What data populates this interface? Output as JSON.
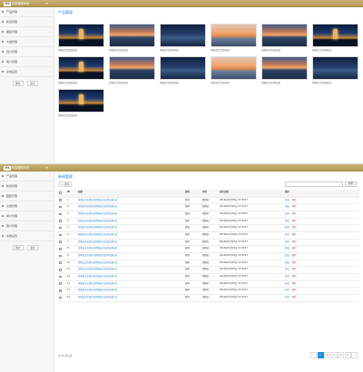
{
  "app": {
    "logo": "MK",
    "title": "内容管理系统",
    "menu_toggle": "≡"
  },
  "sidebar": {
    "items": [
      {
        "label": "产品管理"
      },
      {
        "label": "新闻管理"
      },
      {
        "label": "图集管理"
      },
      {
        "label": "文章管理"
      },
      {
        "label": "用户管理"
      },
      {
        "label": "客户管理"
      },
      {
        "label": "系统设置"
      }
    ],
    "btn_refresh": "刷新",
    "btn_logout": "退出"
  },
  "top_panel": {
    "title": "产品管理",
    "thumbs": [
      {
        "caption": "游客安全出游标语",
        "scene": "night-tower"
      },
      {
        "caption": "游客安全出游标语",
        "scene": "sunset-sea"
      },
      {
        "caption": "游客安全出游标语",
        "scene": "city-night"
      },
      {
        "caption": "游客安全出游标语",
        "scene": "sunset-orange"
      },
      {
        "caption": "游客安全出游标语",
        "scene": "sunset-sea"
      },
      {
        "caption": "游客安全出游标语",
        "scene": "night-tower"
      },
      {
        "caption": "游客安全出游标语",
        "scene": "night-tower"
      },
      {
        "caption": "游客安全出游标语",
        "scene": "sunset-sea"
      },
      {
        "caption": "游客安全出游标语",
        "scene": "city-night"
      },
      {
        "caption": "游客安全出游标语",
        "scene": "sunset-orange"
      },
      {
        "caption": "游客安全出游标语",
        "scene": "sunset-sea"
      },
      {
        "caption": "游客安全出游标语",
        "scene": "city-night"
      },
      {
        "caption": "游客安全出游标语",
        "scene": "night-tower"
      }
    ]
  },
  "bottom_panel": {
    "title": "新闻管理",
    "add_label": "+ 添加",
    "search_placeholder": "",
    "search_btn": "搜索",
    "columns": [
      "ID",
      "标题",
      "类型",
      "作者",
      "发布日期",
      "操作"
    ],
    "rows": [
      {
        "id": "1",
        "title": "游客安全出游标语游客安全出游标语标语",
        "type": "新闻",
        "author": "管理员",
        "date": "2014年03月03日 15:30:07"
      },
      {
        "id": "2",
        "title": "游客安全出游标语游客安全出游标语标语",
        "type": "新闻",
        "author": "管理员",
        "date": "2014年03月03日 15:30:07"
      },
      {
        "id": "3",
        "title": "游客安全出游标语游客安全出游标语标语",
        "type": "新闻",
        "author": "管理员",
        "date": "2014年03月03日 15:30:07"
      },
      {
        "id": "4",
        "title": "游客安全出游标语游客安全出游标语标语",
        "type": "新闻",
        "author": "管理员",
        "date": "2014年03月03日 15:30:07"
      },
      {
        "id": "5",
        "title": "游客安全出游标语游客安全出游标语标语",
        "type": "新闻",
        "author": "管理员",
        "date": "2014年03月03日 15:30:07"
      },
      {
        "id": "6",
        "title": "游客安全出游标语游客安全出游标语标语",
        "type": "新闻",
        "author": "管理员",
        "date": "2014年03月03日 15:30:07"
      },
      {
        "id": "7",
        "title": "游客安全出游标语游客安全出游标语标语",
        "type": "新闻",
        "author": "管理员",
        "date": "2014年03月03日 15:30:07"
      },
      {
        "id": "8",
        "title": "游客安全出游标语游客安全出游标语标语",
        "type": "新闻",
        "author": "管理员",
        "date": "2014年03月03日 15:30:07"
      },
      {
        "id": "9",
        "title": "游客安全出游标语游客安全出游标语标语",
        "type": "新闻",
        "author": "管理员",
        "date": "2014年03月03日 15:30:07"
      },
      {
        "id": "10",
        "title": "游客安全出游标语游客安全出游标语标语",
        "type": "新闻",
        "author": "管理员",
        "date": "2014年03月03日 15:30:07"
      },
      {
        "id": "11",
        "title": "游客安全出游标语游客安全出游标语标语",
        "type": "新闻",
        "author": "管理员",
        "date": "2014年03月03日 15:30:07"
      },
      {
        "id": "12",
        "title": "游客安全出游标语游客安全出游标语标语",
        "type": "新闻",
        "author": "管理员",
        "date": "2014年03月03日 15:30:07"
      },
      {
        "id": "13",
        "title": "游客安全出游标语游客安全出游标语标语",
        "type": "新闻",
        "author": "管理员",
        "date": "2014年03月03日 15:30:07"
      },
      {
        "id": "14",
        "title": "游客安全出游标语游客安全出游标语标语",
        "type": "新闻",
        "author": "管理员",
        "date": "2014年03月03日 15:30:07"
      },
      {
        "id": "15",
        "title": "游客安全出游标语游客安全出游标语标语",
        "type": "新闻",
        "author": "管理员",
        "date": "2014年03月03日 15:30:07"
      }
    ],
    "action_edit": "修改",
    "action_delete": "删除",
    "total_text": "共 15 条记录",
    "pager": [
      "‹",
      "1",
      "2",
      "3",
      "4",
      "5",
      "›"
    ],
    "active_page": "1"
  },
  "colors": {
    "topbar": "#b59a55",
    "accent": "#1f7fcf",
    "danger": "#d9534f",
    "pager_active": "#1f8fd8"
  }
}
